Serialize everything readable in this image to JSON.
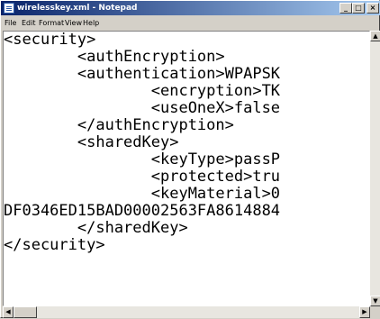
{
  "window": {
    "title": "wirelesskey.xml - Notepad"
  },
  "menu": [
    {
      "label": "File"
    },
    {
      "label": "Edit"
    },
    {
      "label": "Format"
    },
    {
      "label": "View"
    },
    {
      "label": "Help"
    }
  ],
  "editor": {
    "lines": [
      "<security>",
      "        <authEncryption>",
      "        <authentication>WPAPSK",
      "                <encryption>TK",
      "                <useOneX>false",
      "        </authEncryption>",
      "        <sharedKey>",
      "                <keyType>passP",
      "                <protected>tru",
      "                <keyMaterial>0",
      "DF0346ED15BAD00002563FA8614884",
      "        </sharedKey>",
      "</security>"
    ]
  }
}
